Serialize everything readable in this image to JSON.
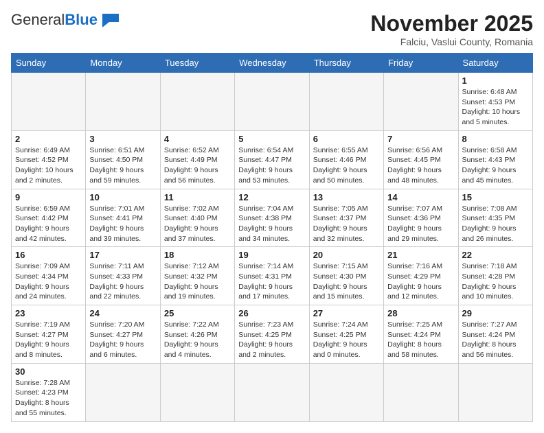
{
  "header": {
    "logo_general": "General",
    "logo_blue": "Blue",
    "month_title": "November 2025",
    "subtitle": "Falciu, Vaslui County, Romania"
  },
  "weekdays": [
    "Sunday",
    "Monday",
    "Tuesday",
    "Wednesday",
    "Thursday",
    "Friday",
    "Saturday"
  ],
  "weeks": [
    [
      {
        "day": null,
        "info": null
      },
      {
        "day": null,
        "info": null
      },
      {
        "day": null,
        "info": null
      },
      {
        "day": null,
        "info": null
      },
      {
        "day": null,
        "info": null
      },
      {
        "day": null,
        "info": null
      },
      {
        "day": "1",
        "info": "Sunrise: 6:48 AM\nSunset: 4:53 PM\nDaylight: 10 hours and 5 minutes."
      }
    ],
    [
      {
        "day": "2",
        "info": "Sunrise: 6:49 AM\nSunset: 4:52 PM\nDaylight: 10 hours and 2 minutes."
      },
      {
        "day": "3",
        "info": "Sunrise: 6:51 AM\nSunset: 4:50 PM\nDaylight: 9 hours and 59 minutes."
      },
      {
        "day": "4",
        "info": "Sunrise: 6:52 AM\nSunset: 4:49 PM\nDaylight: 9 hours and 56 minutes."
      },
      {
        "day": "5",
        "info": "Sunrise: 6:54 AM\nSunset: 4:47 PM\nDaylight: 9 hours and 53 minutes."
      },
      {
        "day": "6",
        "info": "Sunrise: 6:55 AM\nSunset: 4:46 PM\nDaylight: 9 hours and 50 minutes."
      },
      {
        "day": "7",
        "info": "Sunrise: 6:56 AM\nSunset: 4:45 PM\nDaylight: 9 hours and 48 minutes."
      },
      {
        "day": "8",
        "info": "Sunrise: 6:58 AM\nSunset: 4:43 PM\nDaylight: 9 hours and 45 minutes."
      }
    ],
    [
      {
        "day": "9",
        "info": "Sunrise: 6:59 AM\nSunset: 4:42 PM\nDaylight: 9 hours and 42 minutes."
      },
      {
        "day": "10",
        "info": "Sunrise: 7:01 AM\nSunset: 4:41 PM\nDaylight: 9 hours and 39 minutes."
      },
      {
        "day": "11",
        "info": "Sunrise: 7:02 AM\nSunset: 4:40 PM\nDaylight: 9 hours and 37 minutes."
      },
      {
        "day": "12",
        "info": "Sunrise: 7:04 AM\nSunset: 4:38 PM\nDaylight: 9 hours and 34 minutes."
      },
      {
        "day": "13",
        "info": "Sunrise: 7:05 AM\nSunset: 4:37 PM\nDaylight: 9 hours and 32 minutes."
      },
      {
        "day": "14",
        "info": "Sunrise: 7:07 AM\nSunset: 4:36 PM\nDaylight: 9 hours and 29 minutes."
      },
      {
        "day": "15",
        "info": "Sunrise: 7:08 AM\nSunset: 4:35 PM\nDaylight: 9 hours and 26 minutes."
      }
    ],
    [
      {
        "day": "16",
        "info": "Sunrise: 7:09 AM\nSunset: 4:34 PM\nDaylight: 9 hours and 24 minutes."
      },
      {
        "day": "17",
        "info": "Sunrise: 7:11 AM\nSunset: 4:33 PM\nDaylight: 9 hours and 22 minutes."
      },
      {
        "day": "18",
        "info": "Sunrise: 7:12 AM\nSunset: 4:32 PM\nDaylight: 9 hours and 19 minutes."
      },
      {
        "day": "19",
        "info": "Sunrise: 7:14 AM\nSunset: 4:31 PM\nDaylight: 9 hours and 17 minutes."
      },
      {
        "day": "20",
        "info": "Sunrise: 7:15 AM\nSunset: 4:30 PM\nDaylight: 9 hours and 15 minutes."
      },
      {
        "day": "21",
        "info": "Sunrise: 7:16 AM\nSunset: 4:29 PM\nDaylight: 9 hours and 12 minutes."
      },
      {
        "day": "22",
        "info": "Sunrise: 7:18 AM\nSunset: 4:28 PM\nDaylight: 9 hours and 10 minutes."
      }
    ],
    [
      {
        "day": "23",
        "info": "Sunrise: 7:19 AM\nSunset: 4:27 PM\nDaylight: 9 hours and 8 minutes."
      },
      {
        "day": "24",
        "info": "Sunrise: 7:20 AM\nSunset: 4:27 PM\nDaylight: 9 hours and 6 minutes."
      },
      {
        "day": "25",
        "info": "Sunrise: 7:22 AM\nSunset: 4:26 PM\nDaylight: 9 hours and 4 minutes."
      },
      {
        "day": "26",
        "info": "Sunrise: 7:23 AM\nSunset: 4:25 PM\nDaylight: 9 hours and 2 minutes."
      },
      {
        "day": "27",
        "info": "Sunrise: 7:24 AM\nSunset: 4:25 PM\nDaylight: 9 hours and 0 minutes."
      },
      {
        "day": "28",
        "info": "Sunrise: 7:25 AM\nSunset: 4:24 PM\nDaylight: 8 hours and 58 minutes."
      },
      {
        "day": "29",
        "info": "Sunrise: 7:27 AM\nSunset: 4:24 PM\nDaylight: 8 hours and 56 minutes."
      }
    ],
    [
      {
        "day": "30",
        "info": "Sunrise: 7:28 AM\nSunset: 4:23 PM\nDaylight: 8 hours and 55 minutes."
      },
      {
        "day": null,
        "info": null
      },
      {
        "day": null,
        "info": null
      },
      {
        "day": null,
        "info": null
      },
      {
        "day": null,
        "info": null
      },
      {
        "day": null,
        "info": null
      },
      {
        "day": null,
        "info": null
      }
    ]
  ]
}
